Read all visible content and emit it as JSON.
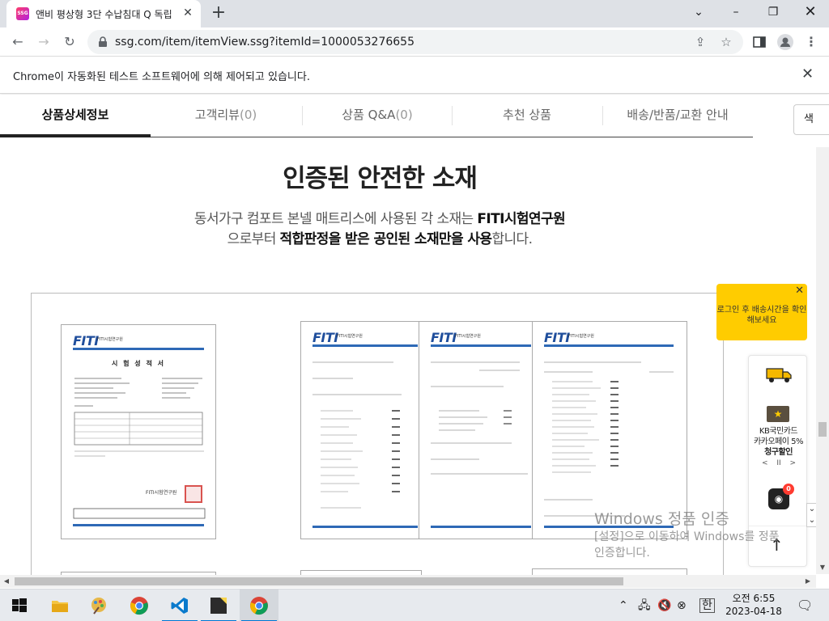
{
  "browser": {
    "tab_title": "앤비 평상형 3단 수납침대 Q 독립",
    "favicon_text": "SSG",
    "url": "ssg.com/item/itemView.ssg?itemId=1000053276655",
    "infobar_text": "Chrome이 자동화된 테스트 소프트웨어에 의해 제어되고 있습니다."
  },
  "detail_tabs": [
    {
      "label": "상품상세정보",
      "count": ""
    },
    {
      "label": "고객리뷰",
      "count": "(0)"
    },
    {
      "label": "상품 Q&A",
      "count": "(0)"
    },
    {
      "label": "추천 상품",
      "count": ""
    },
    {
      "label": "배송/반품/교환 안내",
      "count": ""
    }
  ],
  "side_search_label": "색",
  "content": {
    "heading": "인증된 안전한 소재",
    "desc_line1_pre": "동서가구 컴포트 본넬 매트리스에 사용된 각 소재는 ",
    "desc_line1_bold": "FITI시험연구원",
    "desc_line2_pre": "으로부터 ",
    "desc_line2_bold": "적합판정을 받은 공인된 소재만을 사용",
    "desc_line2_post": "합니다."
  },
  "documents": {
    "logo": "FITI",
    "logo_sub": "FITI시험연구원",
    "cert_title": "시 험 성 적 서",
    "signature": "FITI시험연구원"
  },
  "floating": {
    "login_tip": "로그인 후 배송시간을 확인해보세요",
    "kb_logo": "★",
    "promo_line1": "KB국민카드",
    "promo_line2": "카카오페이 5%",
    "promo_line3": "청구할인",
    "promo_prev": "<",
    "promo_pause": "II",
    "promo_next": ">",
    "chat_badge": "0"
  },
  "watermark": {
    "title": "Windows 정품 인증",
    "line1": "[설정]으로 이동하여 Windows를 정품",
    "line2": "인증합니다."
  },
  "taskbar": {
    "clock_time": "오전 6:55",
    "clock_date": "2023-04-18",
    "ime": "한"
  },
  "colors": {
    "accent_blue": "#2e69b6",
    "tip_yellow": "#ffcc00",
    "badge_red": "#ff3b30"
  }
}
